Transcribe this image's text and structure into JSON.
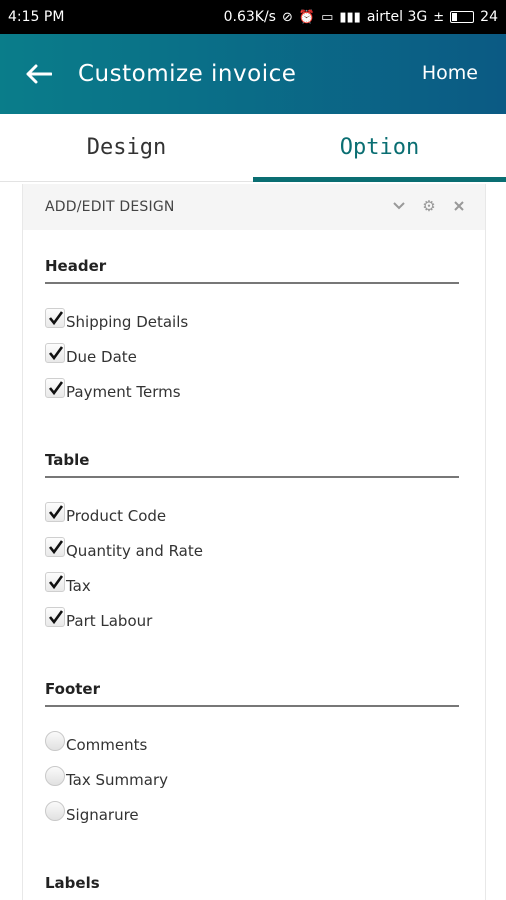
{
  "status_bar": {
    "time": "4:15 PM",
    "speed": "0.63K/s",
    "carrier": "airtel 3G",
    "battery": "24",
    "battery_level": 0.24
  },
  "app_bar": {
    "title": "Customize invoice",
    "home_label": "Home"
  },
  "tabs": [
    {
      "label": "Design",
      "active": false
    },
    {
      "label": "Option",
      "active": true
    }
  ],
  "panel": {
    "title": "ADD/EDIT DESIGN"
  },
  "sections": {
    "header": {
      "title": "Header",
      "options": [
        {
          "label": "Shipping Details",
          "checked": true
        },
        {
          "label": "Due Date",
          "checked": true
        },
        {
          "label": "Payment Terms",
          "checked": true
        }
      ]
    },
    "table": {
      "title": "Table",
      "options": [
        {
          "label": "Product Code",
          "checked": true
        },
        {
          "label": "Quantity and Rate",
          "checked": true
        },
        {
          "label": "Tax",
          "checked": true
        },
        {
          "label": "Part Labour",
          "checked": true
        }
      ]
    },
    "footer": {
      "title": "Footer",
      "options": [
        {
          "label": "Comments",
          "checked": false
        },
        {
          "label": "Tax Summary",
          "checked": false
        },
        {
          "label": "Signarure",
          "checked": false
        }
      ]
    },
    "labels": {
      "title": "Labels"
    }
  },
  "colors": {
    "accent": "#0a6e72",
    "app_bar_start": "#0a7d8a",
    "app_bar_end": "#0b5a84"
  }
}
